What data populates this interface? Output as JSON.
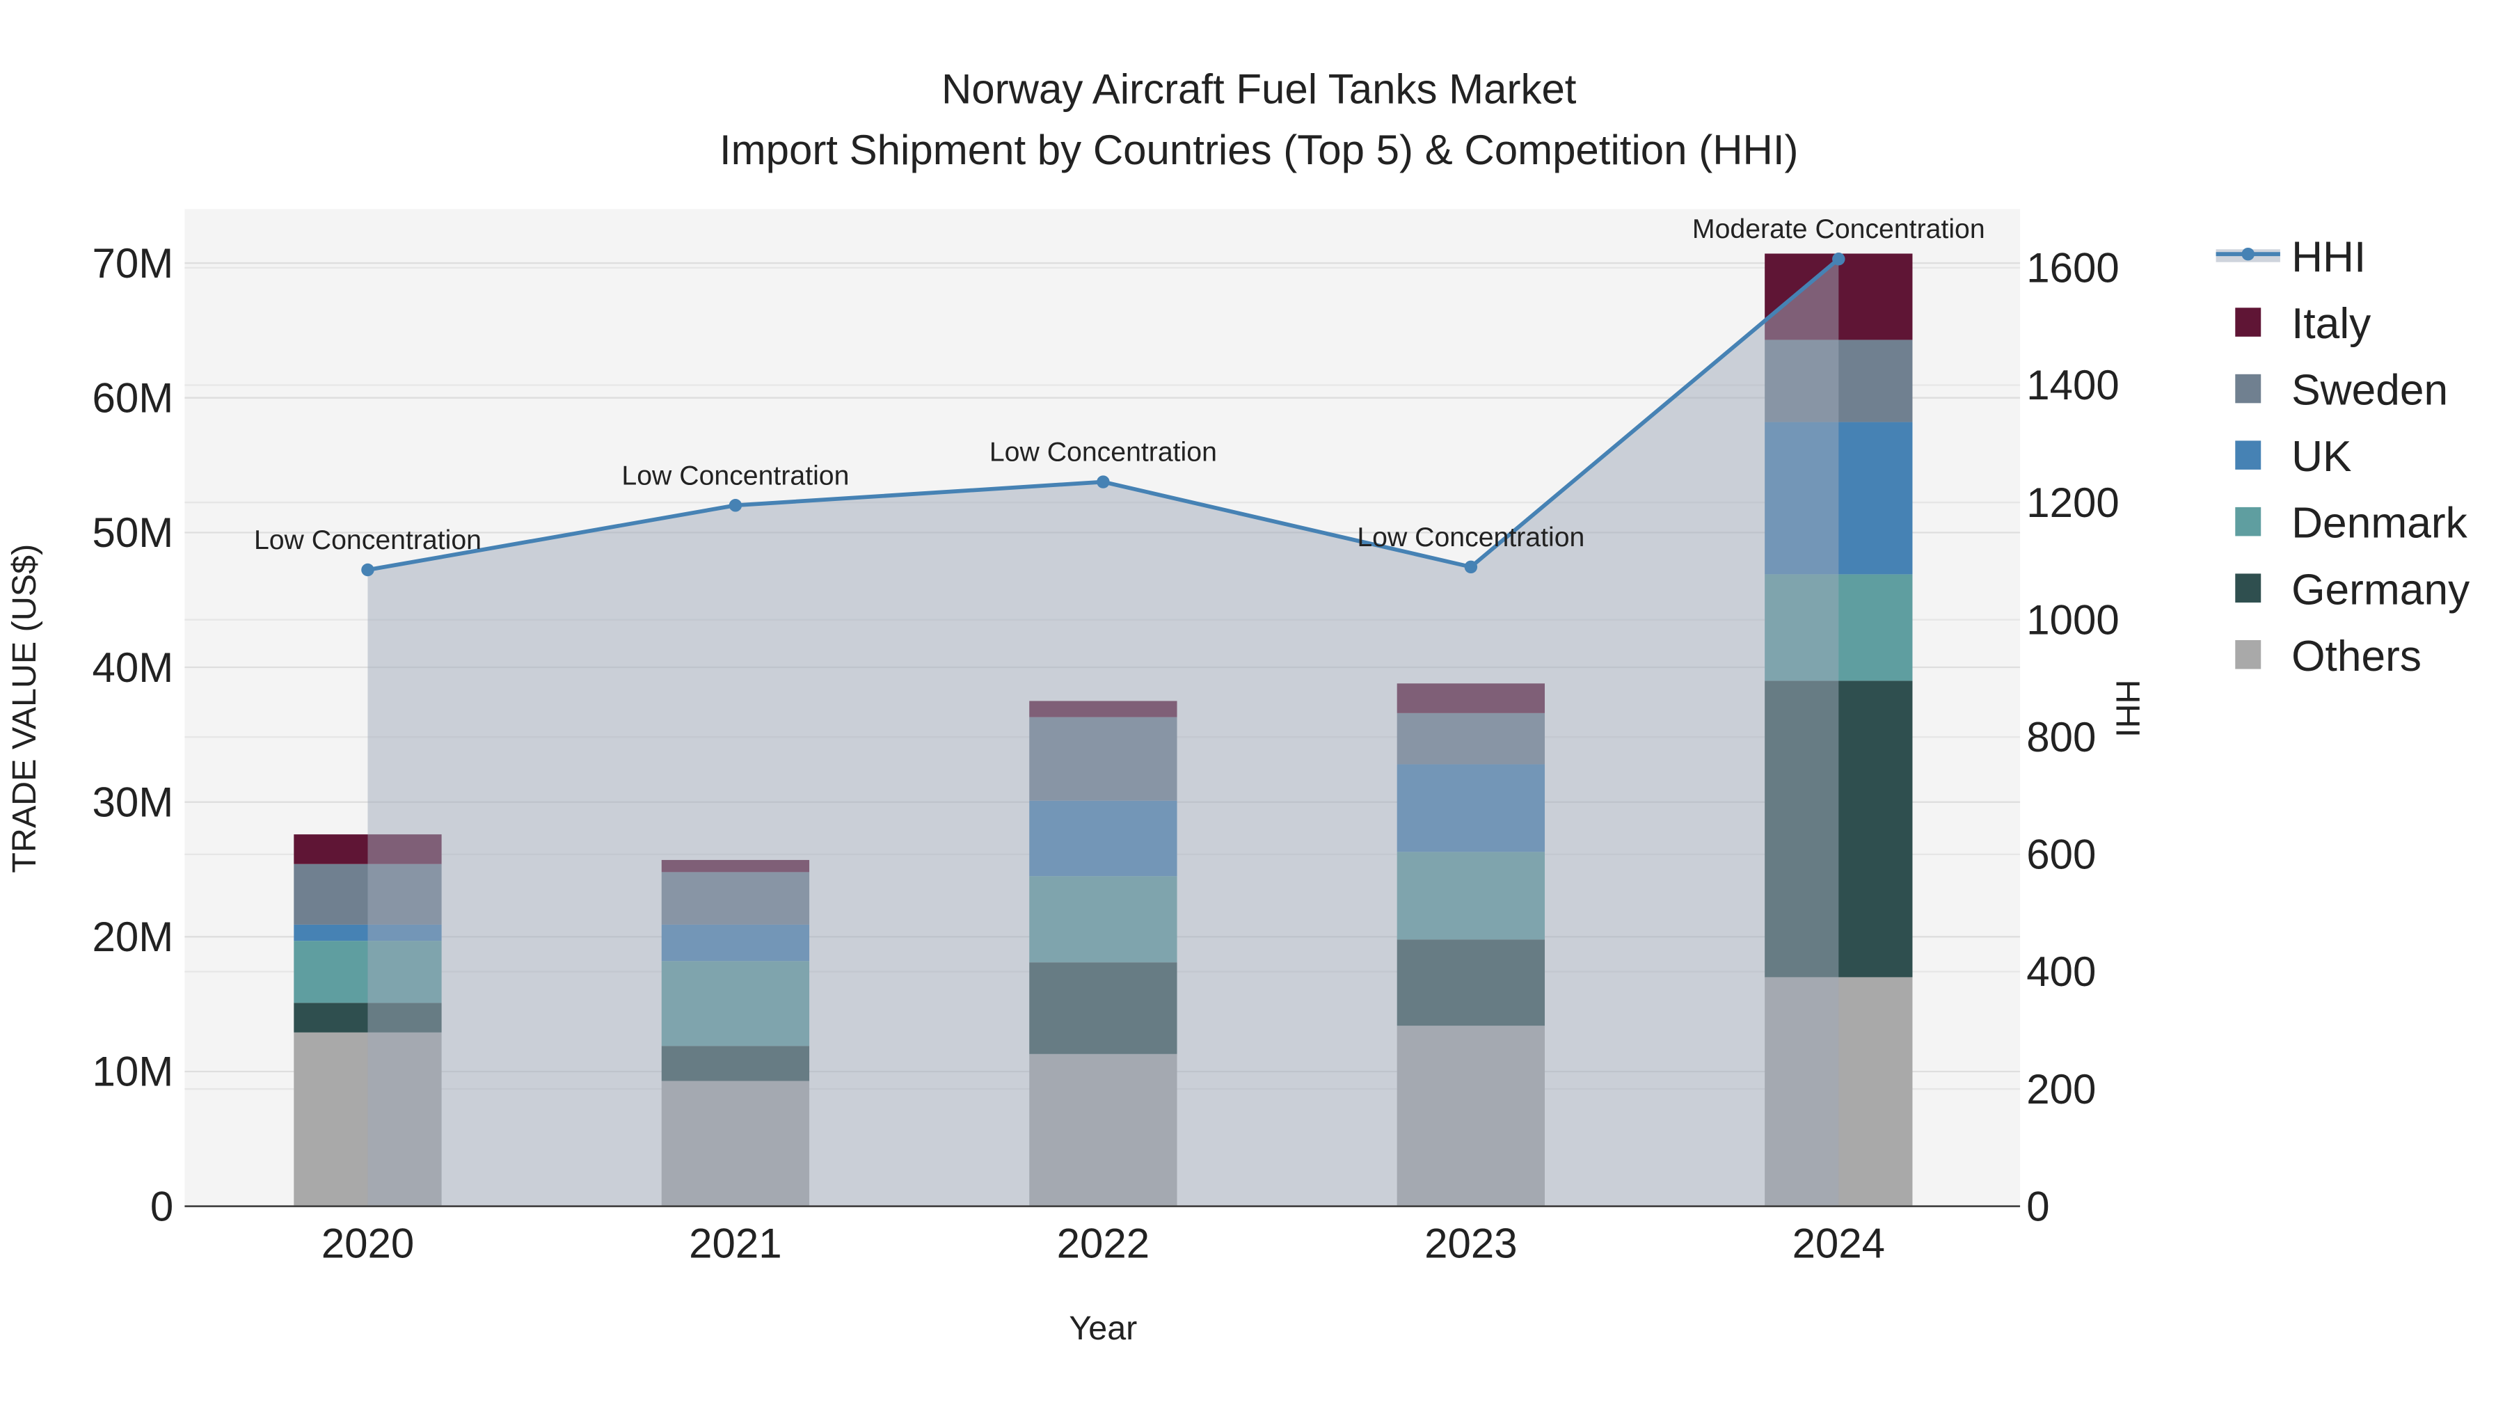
{
  "chart_data": {
    "type": "bar",
    "stacked": true,
    "title": "Norway Aircraft Fuel Tanks Market",
    "subtitle": "Import Shipment by Countries (Top 5) & Competition (HHI)",
    "xlabel": "Year",
    "ylabel": "TRADE VALUE (US$)",
    "y2label": "HHI",
    "categories": [
      "2020",
      "2021",
      "2022",
      "2023",
      "2024"
    ],
    "ylim": [
      0,
      74000000
    ],
    "y2lim": [
      0,
      1700
    ],
    "yticks": [
      0,
      10000000,
      20000000,
      30000000,
      40000000,
      50000000,
      60000000,
      70000000
    ],
    "yticklabels": [
      "0",
      "10M",
      "20M",
      "30M",
      "40M",
      "50M",
      "60M",
      "70M"
    ],
    "y2ticks": [
      0,
      200,
      400,
      600,
      800,
      1000,
      1200,
      1400,
      1600
    ],
    "series": [
      {
        "name": "Others",
        "color": "#a9a9a9",
        "values": [
          12900000,
          9300000,
          11300000,
          13400000,
          17000000
        ]
      },
      {
        "name": "Germany",
        "color": "#2f4f4f",
        "values": [
          2200000,
          2600000,
          6800000,
          6400000,
          22000000
        ]
      },
      {
        "name": "Denmark",
        "color": "#5f9ea0",
        "values": [
          4600000,
          6300000,
          6400000,
          6500000,
          7900000
        ]
      },
      {
        "name": "UK",
        "color": "#4682b4",
        "values": [
          1200000,
          2700000,
          5600000,
          6500000,
          11300000
        ]
      },
      {
        "name": "Sweden",
        "color": "#708090",
        "values": [
          4500000,
          3900000,
          6200000,
          3800000,
          6100000
        ]
      },
      {
        "name": "Italy",
        "color": "#5f1535",
        "values": [
          2200000,
          900000,
          1200000,
          2200000,
          6400000
        ]
      }
    ],
    "hhi": {
      "name": "HHI",
      "color": "#4682b4",
      "values": [
        1085,
        1195,
        1235,
        1090,
        1615
      ],
      "annotations": [
        "Low Concentration",
        "Low Concentration",
        "Low Concentration",
        "Low Concentration",
        "Moderate Concentration"
      ]
    },
    "legend": [
      "HHI",
      "Italy",
      "Sweden",
      "UK",
      "Denmark",
      "Germany",
      "Others"
    ],
    "legend_position": "right",
    "grid": true
  }
}
